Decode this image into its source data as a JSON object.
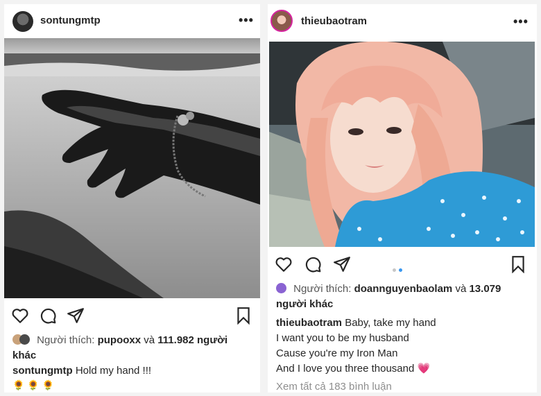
{
  "left_post": {
    "username": "sontungmtp",
    "more_label": "•••",
    "likes_prefix": "Người thích:",
    "liker": "pupooxx",
    "likes_and": "và",
    "likes_rest": "111.982 người khác",
    "caption_user": "sontungmtp",
    "caption_text": "Hold my hand !!!",
    "caption_emoji": "🌻 🌻 🌻"
  },
  "right_post": {
    "username": "thieubaotram",
    "more_label": "•••",
    "likes_prefix": "Người thích:",
    "liker": "doannguyenbaolam",
    "likes_and": "và",
    "likes_rest": "13.079 người khác",
    "caption_user": "thieubaotram",
    "caption_lines": [
      "Baby, take my hand",
      "I want you to be my husband",
      "Cause you're my Iron Man",
      "And I love you three thousand"
    ],
    "caption_heart": "💗",
    "view_comments": "Xem tất cả 183 bình luận",
    "carousel_pages": 2,
    "carousel_active": 2
  },
  "colors": {
    "text": "#262626",
    "muted": "#8e8e8e",
    "dot_active": "#3897f0",
    "dot_inactive": "#c7c7c7",
    "hair": "#f2b8a6",
    "dress": "#2e9bd6"
  },
  "icons": [
    "heart-icon",
    "comment-icon",
    "share-icon",
    "bookmark-icon",
    "more-icon"
  ]
}
